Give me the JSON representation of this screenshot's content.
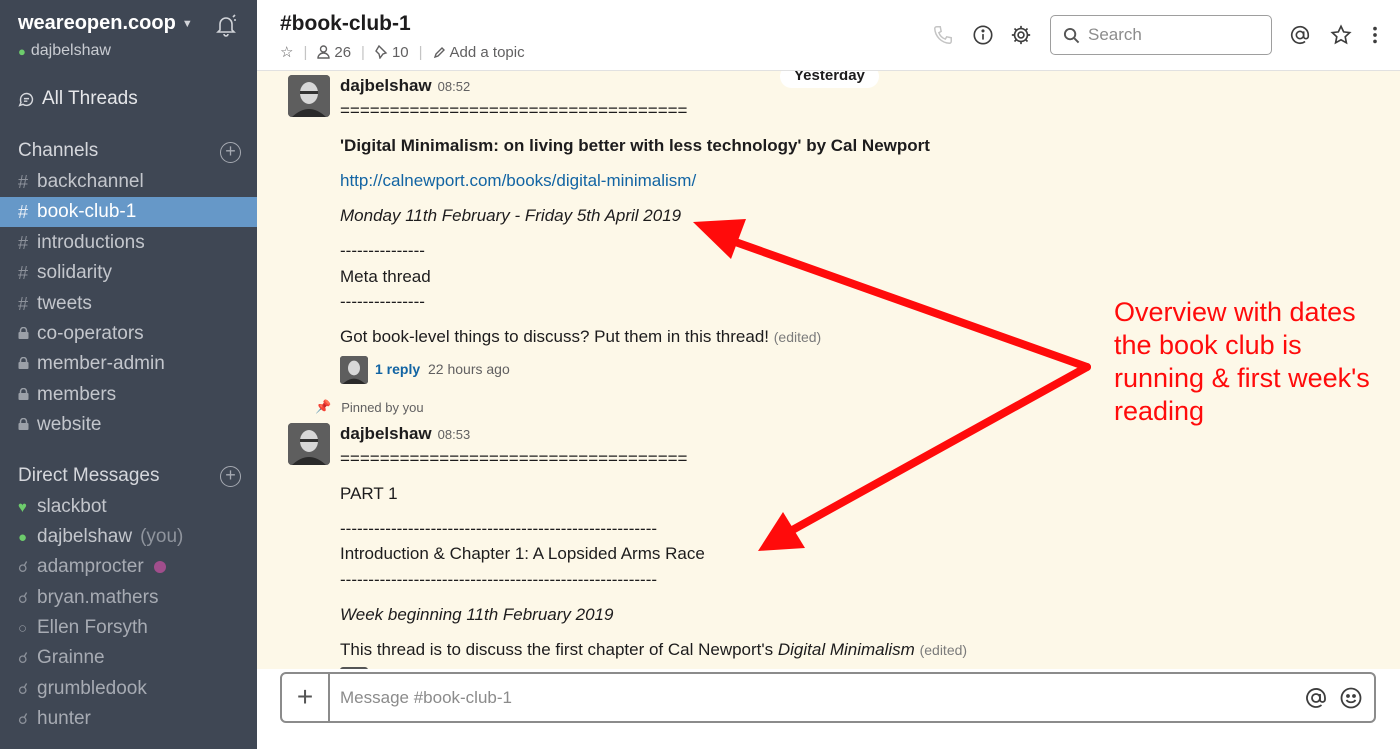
{
  "workspace": {
    "name": "weareopen.coop",
    "user": "dajbelshaw"
  },
  "sidebar": {
    "all_threads": "All Threads",
    "channels_heading": "Channels",
    "channels": [
      {
        "label": "backchannel",
        "type": "public"
      },
      {
        "label": "book-club-1",
        "type": "public",
        "active": true
      },
      {
        "label": "introductions",
        "type": "public"
      },
      {
        "label": "solidarity",
        "type": "public"
      },
      {
        "label": "tweets",
        "type": "public"
      },
      {
        "label": "co-operators",
        "type": "private"
      },
      {
        "label": "member-admin",
        "type": "private"
      },
      {
        "label": "members",
        "type": "private"
      },
      {
        "label": "website",
        "type": "private"
      }
    ],
    "dm_heading": "Direct Messages",
    "dms": [
      {
        "label": "slackbot",
        "status": "bot"
      },
      {
        "label": "dajbelshaw",
        "status": "active",
        "suffix": "(you)"
      },
      {
        "label": "adamprocter",
        "status": "away-dnd"
      },
      {
        "label": "bryan.mathers",
        "status": "away-dnd"
      },
      {
        "label": "Ellen Forsyth",
        "status": "away"
      },
      {
        "label": "Grainne",
        "status": "away-dnd"
      },
      {
        "label": "grumbledook",
        "status": "away-dnd"
      },
      {
        "label": "hunter",
        "status": "away-dnd"
      }
    ]
  },
  "header": {
    "channel": "#book-club-1",
    "members": "26",
    "pins": "10",
    "add_topic": "Add a topic",
    "search_placeholder": "Search"
  },
  "messages": {
    "day_divider": "Yesterday",
    "msg1": {
      "author": "dajbelshaw",
      "time": "08:52",
      "separator": "===================================",
      "title": "'Digital Minimalism: on living better with less technology' by Cal Newport",
      "link": "http://calnewport.com/books/digital-minimalism/",
      "dates": "Monday 11th February - Friday 5th April 2019",
      "dash1": "---------------",
      "meta": "Meta thread",
      "dash2": "---------------",
      "body": "Got book-level things to discuss? Put them in this thread!",
      "edited": "(edited)",
      "reply_count": "1 reply",
      "reply_time": "22 hours ago"
    },
    "pinned_label": "Pinned by you",
    "msg2": {
      "author": "dajbelshaw",
      "time": "08:53",
      "separator": "===================================",
      "part": "PART 1",
      "dash1": "--------------------------------------------------------",
      "chapter": "Introduction & Chapter 1: A Lopsided Arms Race",
      "dash2": "--------------------------------------------------------",
      "week": "Week beginning 11th February 2019",
      "body_start": "This thread is to discuss the first chapter of Cal Newport's ",
      "body_italic": "Digital Minimalism",
      "edited": "(edited)"
    }
  },
  "annotation": {
    "text": "Overview with dates the book club is running & first week's reading",
    "color": "#ff0b0b"
  },
  "composer": {
    "placeholder": "Message #book-club-1"
  },
  "colors": {
    "sidebar_bg": "#3f4754",
    "active_item": "#6698c8",
    "message_bg": "#fdf8e8",
    "link": "#1264a3"
  }
}
